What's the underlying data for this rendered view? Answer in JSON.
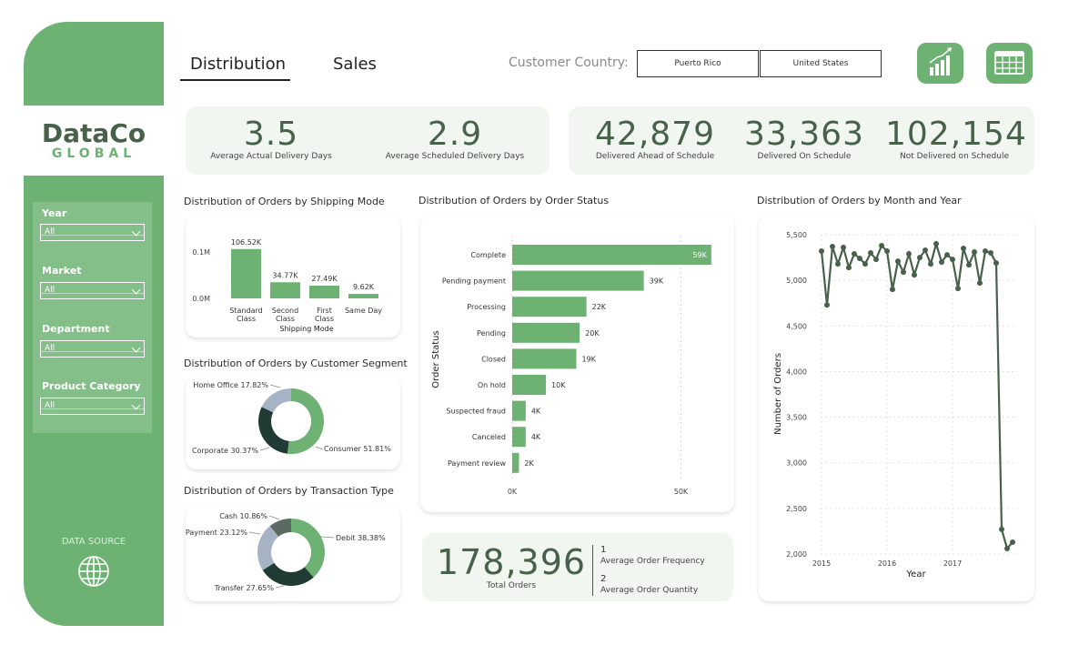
{
  "logo": {
    "main": "DataCo",
    "sub": "GLOBAL"
  },
  "filters": [
    {
      "label": "Year",
      "value": "All"
    },
    {
      "label": "Market",
      "value": "All"
    },
    {
      "label": "Department",
      "value": "All"
    },
    {
      "label": "Product Category",
      "value": "All"
    }
  ],
  "sidebar": {
    "data_source_label": "DATA SOURCE",
    "data_source_icon": "globe-icon"
  },
  "tabs": [
    {
      "label": "Distribution",
      "active": true
    },
    {
      "label": "Sales",
      "active": false
    }
  ],
  "country_filter": {
    "label": "Customer Country:",
    "options": [
      "Puerto Rico",
      "United States"
    ]
  },
  "toolbar": {
    "chart_icon": "bar-chart-growth-icon",
    "table_icon": "table-grid-icon"
  },
  "kpis_left": [
    {
      "value": "3.5",
      "label": "Average Actual Delivery Days"
    },
    {
      "value": "2.9",
      "label": "Average Scheduled Delivery Days"
    }
  ],
  "kpis_right": [
    {
      "value": "42,879",
      "label": "Delivered Ahead of Schedule"
    },
    {
      "value": "33,363",
      "label": "Delivered On Schedule"
    },
    {
      "value": "102,154",
      "label": "Not Delivered on Schedule"
    }
  ],
  "totals": {
    "total_orders": "178,396",
    "total_orders_label": "Total Orders",
    "freq_value": "1",
    "freq_label": "Average Order Frequency",
    "qty_value": "2",
    "qty_label": "Average Order Quantity"
  },
  "colors": {
    "accent": "#6db173",
    "dark": "#47614a",
    "darkest": "#1f3b34",
    "grey": "#a6b3c4",
    "slate": "#5c6b62",
    "card_bg": "#f1f6f1"
  },
  "chart_data": [
    {
      "type": "bar",
      "title": "Distribution of Orders by Shipping Mode",
      "categories": [
        "Standard Class",
        "Second Class",
        "First Class",
        "Same Day"
      ],
      "category_lines": [
        [
          "Standard",
          "Class"
        ],
        [
          "Second",
          "Class"
        ],
        [
          "First",
          "Class"
        ],
        [
          "Same Day"
        ]
      ],
      "values": [
        106520,
        34770,
        27490,
        9620
      ],
      "data_labels": [
        "106.52K",
        "34.77K",
        "27.49K",
        "9.62K"
      ],
      "xlabel": "Shipping Mode",
      "ylabel": "",
      "yticks": [
        "0.0M",
        "0.1M"
      ],
      "ylim": [
        0,
        110000
      ],
      "grid": false
    },
    {
      "type": "pie",
      "title": "Distribution of Orders by Customer Segment",
      "categories": [
        "Consumer",
        "Corporate",
        "Home Office"
      ],
      "values": [
        51.81,
        30.37,
        17.82
      ],
      "data_labels": [
        "Consumer 51.81%",
        "Corporate 30.37%",
        "Home Office 17.82%"
      ],
      "colors": [
        "#6db173",
        "#1f3b34",
        "#a6b3c4"
      ]
    },
    {
      "type": "pie",
      "title": "Distribution of Orders by Transaction Type",
      "categories": [
        "Debit",
        "Transfer",
        "Payment",
        "Cash"
      ],
      "values": [
        38.38,
        27.65,
        23.12,
        10.86
      ],
      "data_labels": [
        "Debit 38.38%",
        "Transfer 27.65%",
        "Payment 23.12%",
        "Cash 10.86%"
      ],
      "colors": [
        "#6db173",
        "#1f3b34",
        "#a6b3c4",
        "#5c6b62"
      ]
    },
    {
      "type": "bar",
      "orientation": "horizontal",
      "title": "Distribution of Orders by Order Status",
      "categories": [
        "Complete",
        "Pending payment",
        "Processing",
        "Pending",
        "Closed",
        "On hold",
        "Suspected fraud",
        "Canceled",
        "Payment review"
      ],
      "values": [
        59000,
        39000,
        22000,
        20000,
        19000,
        10000,
        4000,
        4000,
        2000
      ],
      "data_labels": [
        "59K",
        "39K",
        "22K",
        "20K",
        "19K",
        "10K",
        "4K",
        "4K",
        "2K"
      ],
      "xlabel": "",
      "ylabel": "Order Status",
      "xticks": [
        "0K",
        "50K"
      ],
      "xlim": [
        0,
        62000
      ],
      "grid": true
    },
    {
      "type": "line",
      "title": "Distribution of Orders by Month and Year",
      "xlabel": "Year",
      "ylabel": "Number of Orders",
      "xticks": [
        "2015",
        "2016",
        "2017"
      ],
      "x": [
        "2015-01",
        "2015-02",
        "2015-03",
        "2015-04",
        "2015-05",
        "2015-06",
        "2015-07",
        "2015-08",
        "2015-09",
        "2015-10",
        "2015-11",
        "2015-12",
        "2016-01",
        "2016-02",
        "2016-03",
        "2016-04",
        "2016-05",
        "2016-06",
        "2016-07",
        "2016-08",
        "2016-09",
        "2016-10",
        "2016-11",
        "2016-12",
        "2017-01",
        "2017-02",
        "2017-03",
        "2017-04",
        "2017-05",
        "2017-06",
        "2017-07",
        "2017-08",
        "2017-09",
        "2017-10",
        "2017-11",
        "2017-12",
        "2018-01"
      ],
      "values": [
        5320,
        4730,
        5370,
        5180,
        5360,
        5140,
        5290,
        5240,
        5180,
        5300,
        5230,
        5380,
        5320,
        4900,
        5210,
        5090,
        5290,
        5060,
        5250,
        5330,
        5180,
        5400,
        5200,
        5280,
        5230,
        4910,
        5350,
        5170,
        5310,
        4970,
        5320,
        5300,
        5190,
        2270,
        2060,
        2130
      ],
      "yticks": [
        "2,000",
        "2,500",
        "3,000",
        "3,500",
        "4,000",
        "4,500",
        "5,000",
        "5,500"
      ],
      "ylim": [
        2000,
        5500
      ],
      "grid": true
    }
  ]
}
